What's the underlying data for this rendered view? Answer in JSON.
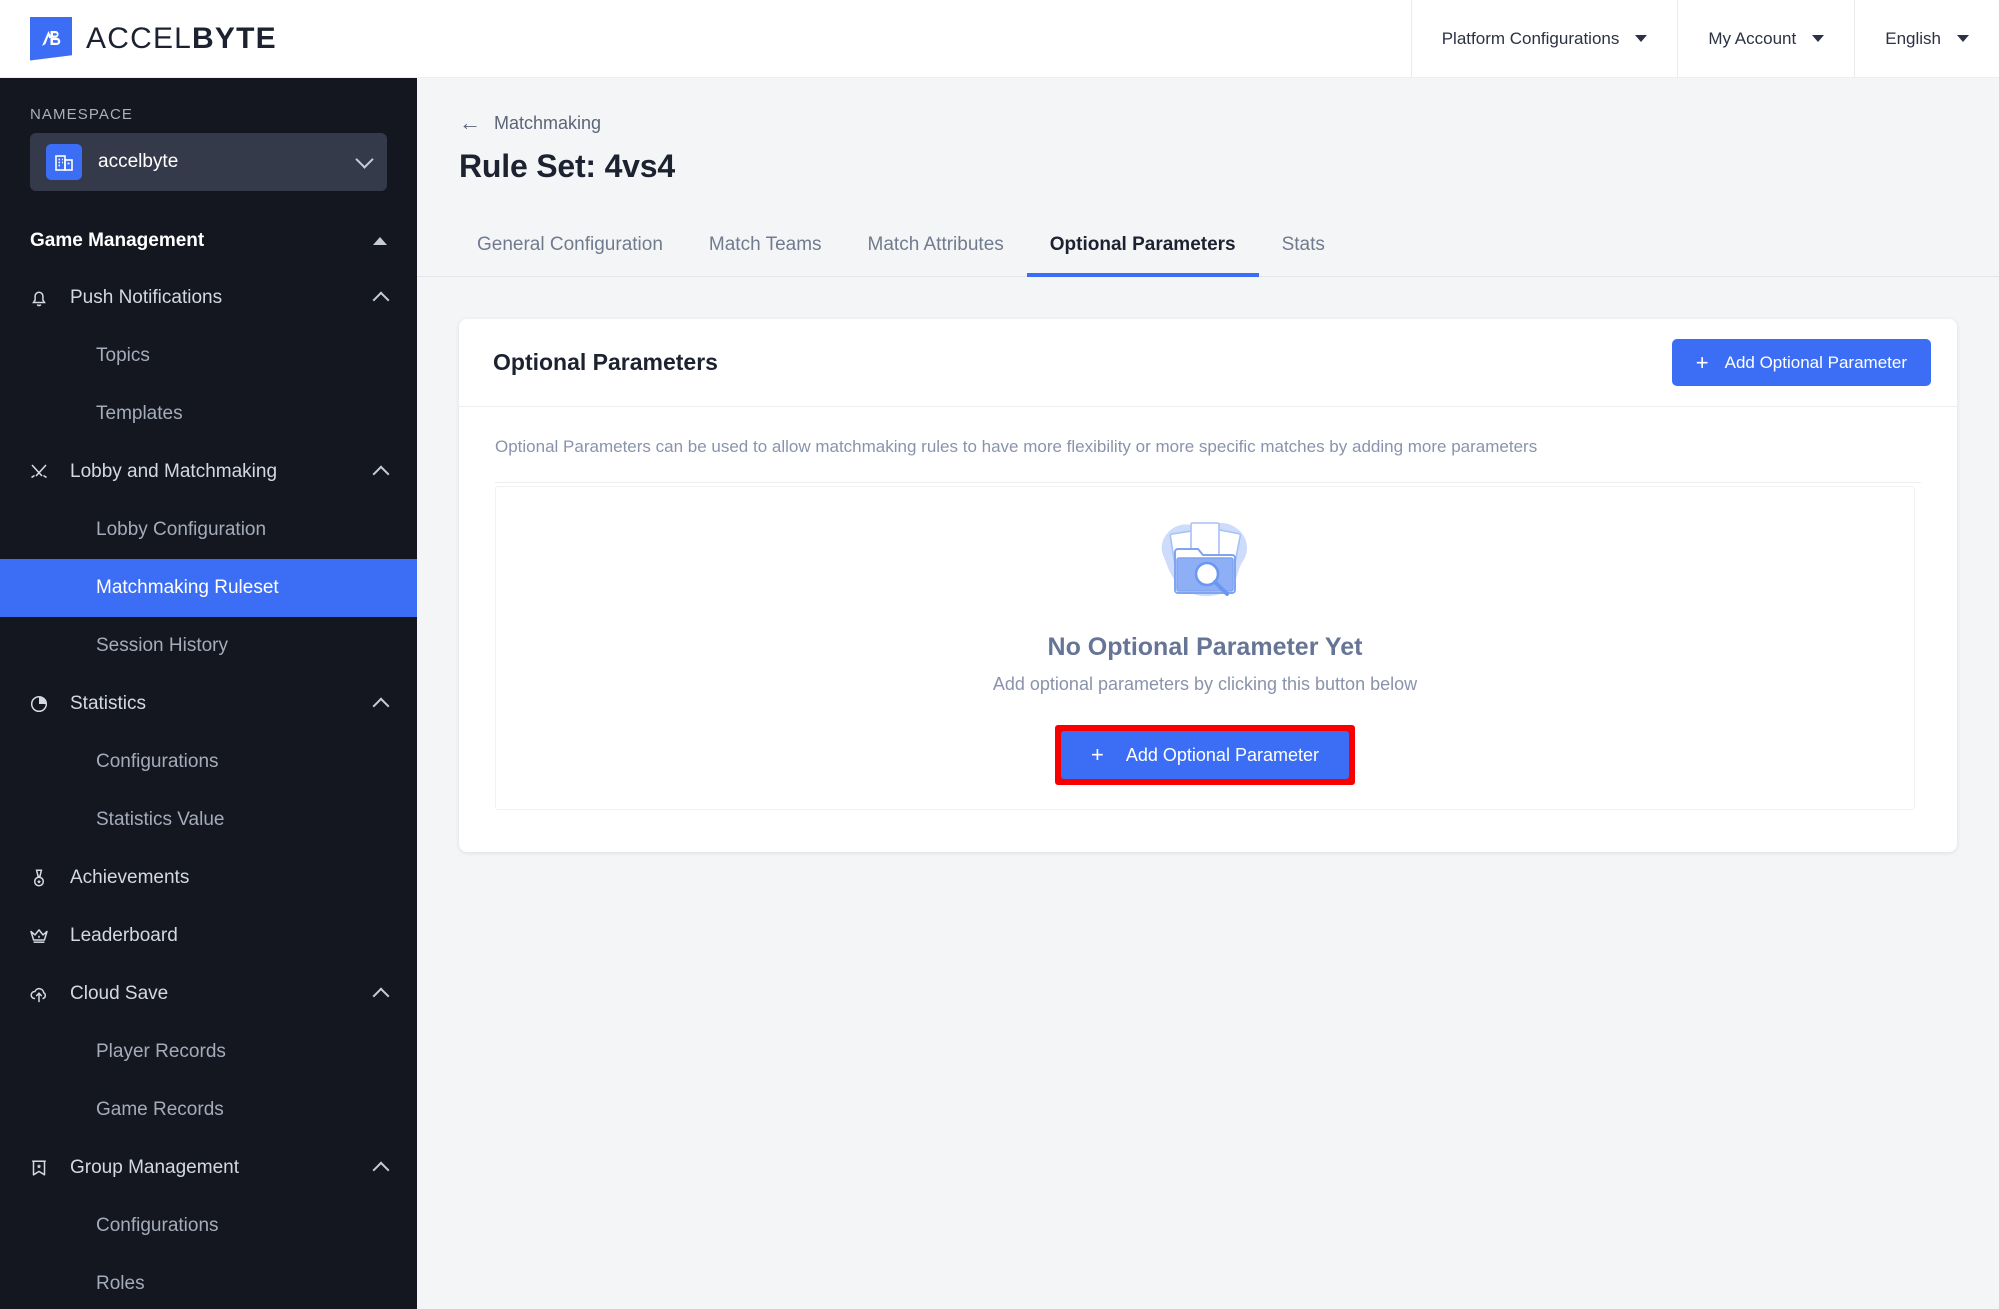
{
  "brand": {
    "name_light": "ACCEL",
    "name_bold": "BYTE",
    "logo_icon": "accelbyte-logo-icon"
  },
  "topnav": [
    {
      "label": "Platform Configurations",
      "icon": "chevron-down-icon"
    },
    {
      "label": "My Account",
      "icon": "chevron-down-icon"
    },
    {
      "label": "English",
      "icon": "chevron-down-icon"
    }
  ],
  "sidebar": {
    "namespace_label": "NAMESPACE",
    "namespace_value": "accelbyte",
    "namespace_icon": "building-icon",
    "namespace_chevron": "chevron-down-icon",
    "section_title": "Game Management",
    "items": [
      {
        "label": "Push Notifications",
        "icon": "bell-icon",
        "type": "group",
        "chevron": "chevron-up-icon"
      },
      {
        "label": "Topics",
        "type": "child"
      },
      {
        "label": "Templates",
        "type": "child"
      },
      {
        "label": "Lobby and Matchmaking",
        "icon": "swords-icon",
        "type": "group",
        "chevron": "chevron-up-icon"
      },
      {
        "label": "Lobby Configuration",
        "type": "child"
      },
      {
        "label": "Matchmaking Ruleset",
        "type": "child",
        "active": true
      },
      {
        "label": "Session History",
        "type": "child"
      },
      {
        "label": "Statistics",
        "icon": "pie-chart-icon",
        "type": "group",
        "chevron": "chevron-up-icon"
      },
      {
        "label": "Configurations",
        "type": "child"
      },
      {
        "label": "Statistics Value",
        "type": "child"
      },
      {
        "label": "Achievements",
        "icon": "medal-icon",
        "type": "group-plain"
      },
      {
        "label": "Leaderboard",
        "icon": "crown-icon",
        "type": "group-plain"
      },
      {
        "label": "Cloud Save",
        "icon": "cloud-upload-icon",
        "type": "group",
        "chevron": "chevron-up-icon"
      },
      {
        "label": "Player Records",
        "type": "child"
      },
      {
        "label": "Game Records",
        "type": "child"
      },
      {
        "label": "Group Management",
        "icon": "banner-icon",
        "type": "group",
        "chevron": "chevron-up-icon"
      },
      {
        "label": "Configurations",
        "type": "child"
      },
      {
        "label": "Roles",
        "type": "child"
      }
    ]
  },
  "main": {
    "breadcrumb": {
      "arrow": "arrow-left-icon",
      "label": "Matchmaking"
    },
    "page_title": "Rule Set: 4vs4",
    "tabs": [
      {
        "label": "General Configuration",
        "active": false
      },
      {
        "label": "Match Teams",
        "active": false
      },
      {
        "label": "Match Attributes",
        "active": false
      },
      {
        "label": "Optional Parameters",
        "active": true
      },
      {
        "label": "Stats",
        "active": false
      }
    ],
    "card": {
      "title": "Optional Parameters",
      "add_button": "Add Optional Parameter",
      "add_button_icon": "plus-icon",
      "description": "Optional Parameters can be used to allow matchmaking rules to have more flexibility or more specific matches by adding more parameters"
    },
    "empty_state": {
      "illustration_icon": "folder-search-icon",
      "title": "No Optional Parameter Yet",
      "subtitle": "Add optional parameters by clicking this button below",
      "button_label": "Add Optional Parameter",
      "button_icon": "plus-icon",
      "highlight_color": "#f80000"
    }
  },
  "colors": {
    "accent_blue": "#3b6ef5",
    "sidebar_bg": "#14171f",
    "sidebar_active": "#3b6ef5",
    "page_bg": "#f4f5f7",
    "muted_text": "#8a93ac"
  }
}
